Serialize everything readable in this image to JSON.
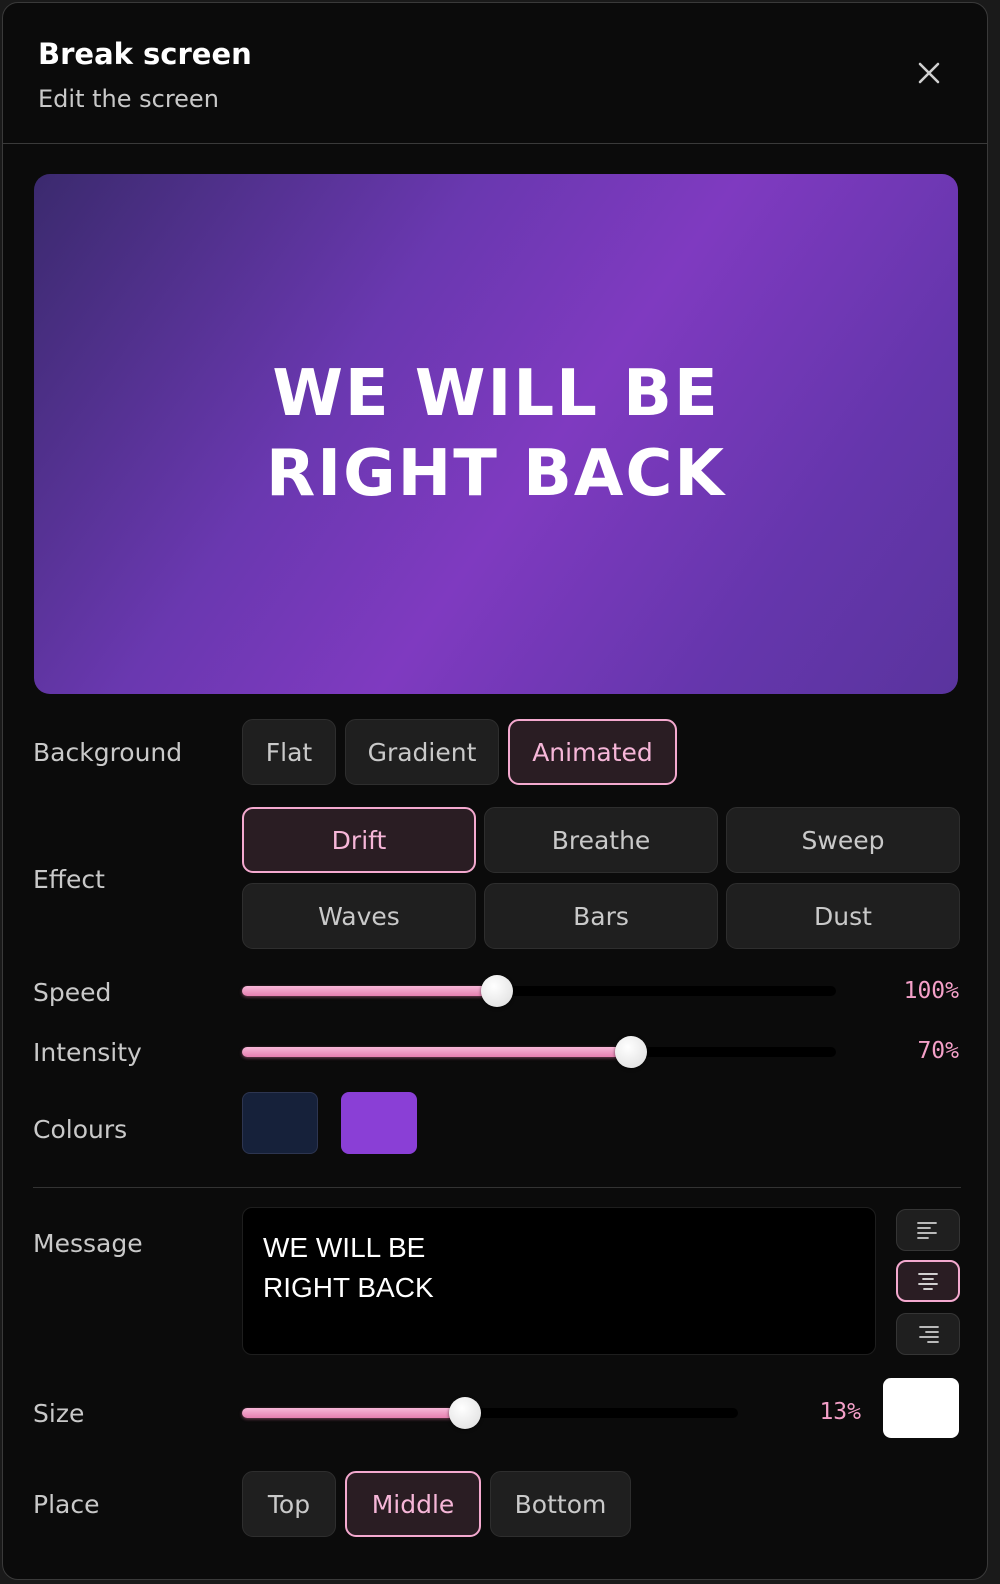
{
  "header": {
    "title": "Break screen",
    "subtitle": "Edit the screen",
    "close_icon": "close-icon"
  },
  "preview": {
    "text": "WE WILL BE\nRIGHT BACK"
  },
  "background": {
    "label": "Background",
    "options": [
      "Flat",
      "Gradient",
      "Animated"
    ],
    "selected": "Animated"
  },
  "effect": {
    "label": "Effect",
    "options": [
      "Drift",
      "Breathe",
      "Sweep",
      "Waves",
      "Bars",
      "Dust"
    ],
    "selected": "Drift"
  },
  "speed": {
    "label": "Speed",
    "value_text": "100%",
    "fill_fraction": 0.43
  },
  "intensity": {
    "label": "Intensity",
    "value_text": "70%",
    "fill_fraction": 0.655
  },
  "colours": {
    "label": "Colours",
    "values": [
      "#16213a",
      "#8a3fd6"
    ]
  },
  "message": {
    "label": "Message",
    "text": "WE WILL BE\nRIGHT BACK",
    "align_options": [
      "align-left-icon",
      "align-center-icon",
      "align-right-icon"
    ],
    "selected_align": "align-center-icon"
  },
  "size": {
    "label": "Size",
    "value_text": "13%",
    "fill_fraction": 0.45,
    "text_colour": "#ffffff"
  },
  "place": {
    "label": "Place",
    "options": [
      "Top",
      "Middle",
      "Bottom"
    ],
    "selected": "Middle"
  },
  "accent_colour": "#f4a9cf"
}
